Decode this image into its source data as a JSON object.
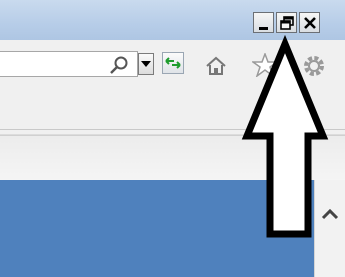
{
  "window_controls": {
    "minimize_icon": "minimize-icon",
    "restore_icon": "restore-icon",
    "close_icon": "close-icon"
  },
  "toolbar": {
    "address_value": "",
    "icons": [
      "search-icon",
      "chevron-down-icon",
      "refresh-icon",
      "home-icon",
      "star-icon",
      "gear-icon"
    ]
  },
  "colors": {
    "titlebar": "#b7cde8",
    "content": "#4f81bd",
    "arrow": "#000000"
  }
}
